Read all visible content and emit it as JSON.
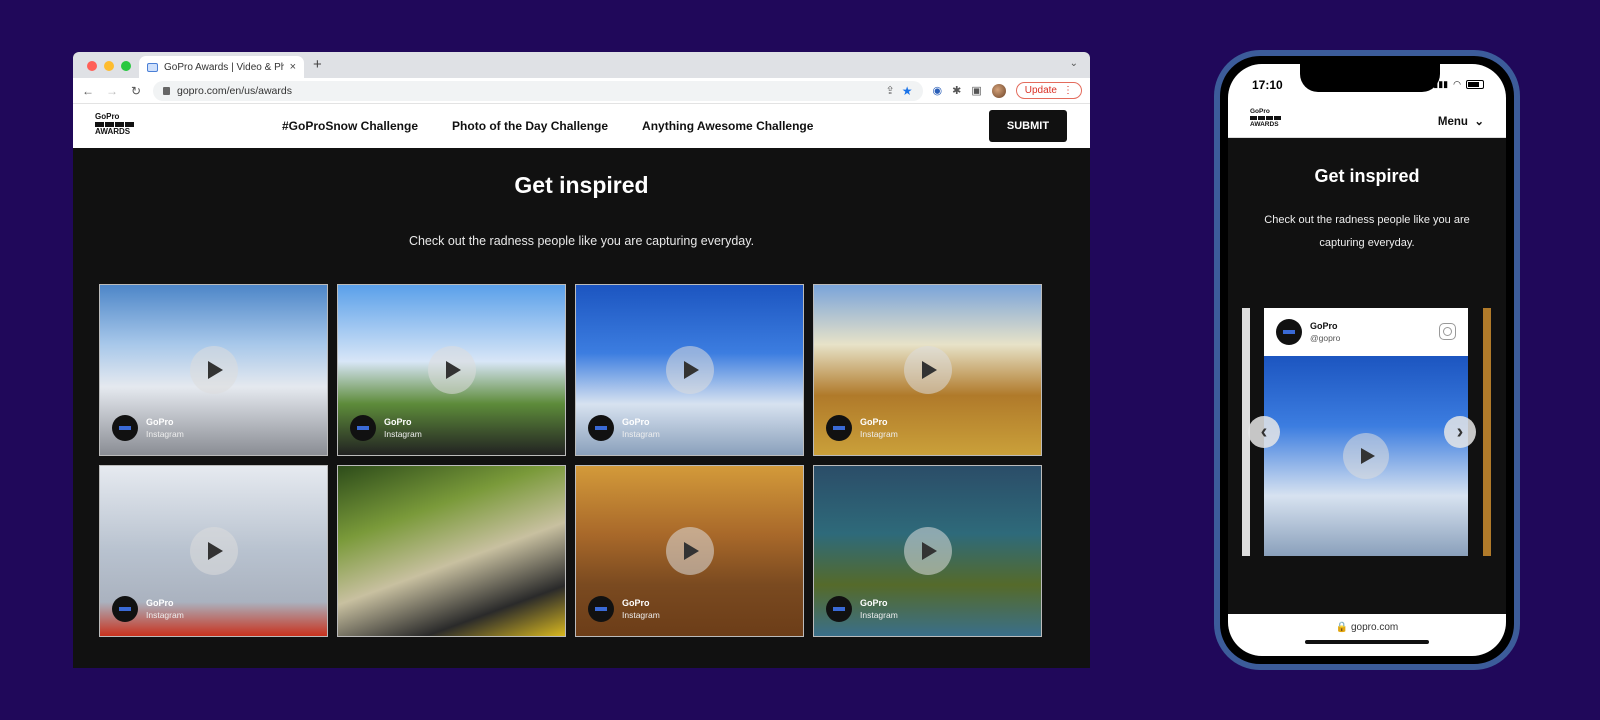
{
  "browser": {
    "tab_title": "GoPro Awards | Video & Photo",
    "tab_close": "×",
    "new_tab": "+",
    "url": "gopro.com/en/us/awards",
    "update_label": "Update",
    "traffic_colors": [
      "#ff5f57",
      "#febc2e",
      "#28c840"
    ]
  },
  "site": {
    "logo_top": "GoPro",
    "logo_bottom": "AWARDS",
    "nav": [
      "#GoProSnow Challenge",
      "Photo of the Day Challenge",
      "Anything Awesome Challenge"
    ],
    "submit_label": "SUBMIT",
    "heading": "Get inspired",
    "subheading": "Check out the radness people like you are capturing everyday.",
    "tiles": [
      {
        "name": "GoPro",
        "source": "Instagram"
      },
      {
        "name": "GoPro",
        "source": "Instagram"
      },
      {
        "name": "GoPro",
        "source": "Instagram"
      },
      {
        "name": "GoPro",
        "source": "Instagram"
      },
      {
        "name": "GoPro",
        "source": "Instagram"
      },
      {
        "name": "",
        "source": ""
      },
      {
        "name": "GoPro",
        "source": "Instagram"
      },
      {
        "name": "GoPro",
        "source": "Instagram"
      }
    ]
  },
  "phone": {
    "time": "17:10",
    "logo_top": "GoPro",
    "logo_bottom": "AWARDS",
    "menu_label": "Menu",
    "heading": "Get inspired",
    "subheading": "Check out the radness people like you are capturing everyday.",
    "card": {
      "name": "GoPro",
      "handle": "@gopro"
    },
    "url": "gopro.com"
  }
}
